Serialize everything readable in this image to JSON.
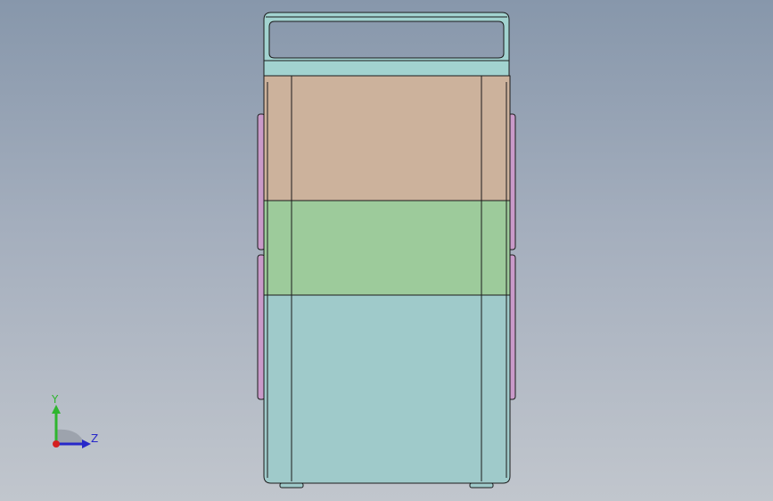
{
  "viewport": {
    "background_top": "#8797ab",
    "background_bottom": "#c1c6cd"
  },
  "model": {
    "colors": {
      "handle": "#a2d3d0",
      "top_section": "#ccb29c",
      "middle_section": "#9dcb9b",
      "bottom_section": "#9fcaca",
      "side_tabs": "#c99ac9",
      "edge_lines": "#1b1b1b"
    }
  },
  "triad": {
    "y_label": "Y",
    "z_label": "Z",
    "y_color": "#2fb52f",
    "z_color": "#2727c9",
    "x_color": "#d41f1f"
  }
}
